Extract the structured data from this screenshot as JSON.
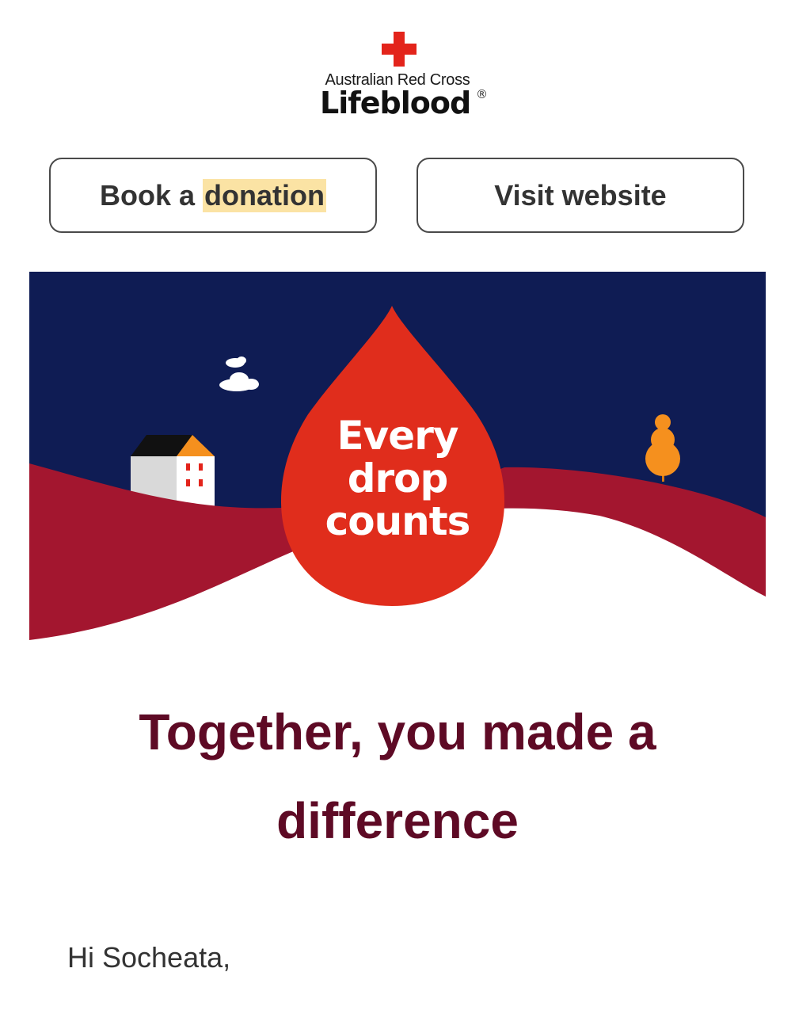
{
  "brand": {
    "line1": "Australian Red Cross",
    "line2": "Lifeblood",
    "registered_mark": "®",
    "accent_color": "#e3241b"
  },
  "actions": {
    "book_prefix": "Book a",
    "book_highlight": "donation",
    "visit_label": "Visit website"
  },
  "banner": {
    "drop_line1": "Every",
    "drop_line2": "drop",
    "drop_line3": "counts",
    "colors": {
      "sky": "#0f1c54",
      "hills": "#a3162f",
      "drop": "#e02d1c",
      "tree": "#f5901e"
    },
    "icons": [
      "cloud-icon",
      "house-icon",
      "tree-icon",
      "blood-drop-icon"
    ]
  },
  "content": {
    "headline": "Together, you made a difference",
    "greeting": "Hi Socheata,"
  }
}
